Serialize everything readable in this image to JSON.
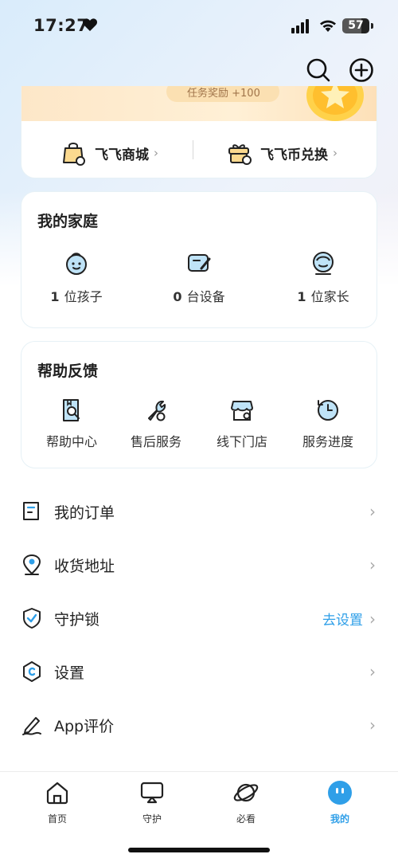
{
  "status_bar": {
    "time": "17:27",
    "battery": "57"
  },
  "header": {
    "icons": [
      "search-icon",
      "add-circle-icon"
    ]
  },
  "shop_card": {
    "banner_text": "任务奖励 +100",
    "items": [
      {
        "label": "飞飞商城",
        "icon": "bag-icon"
      },
      {
        "label": "飞飞币兑换",
        "icon": "gift-exchange-icon"
      }
    ]
  },
  "family": {
    "title": "我的家庭",
    "items": [
      {
        "count": "1",
        "label": "位孩子",
        "icon": "child-face-icon"
      },
      {
        "count": "0",
        "label": "台设备",
        "icon": "tablet-device-icon"
      },
      {
        "count": "1",
        "label": "位家长",
        "icon": "parent-face-icon"
      }
    ]
  },
  "help": {
    "title": "帮助反馈",
    "items": [
      {
        "label": "帮助中心",
        "icon": "help-book-icon"
      },
      {
        "label": "售后服务",
        "icon": "wrench-icon"
      },
      {
        "label": "线下门店",
        "icon": "store-icon"
      },
      {
        "label": "服务进度",
        "icon": "progress-clock-icon"
      }
    ]
  },
  "menu": [
    {
      "label": "我的订单",
      "icon": "order-icon",
      "hint": ""
    },
    {
      "label": "收货地址",
      "icon": "location-icon",
      "hint": ""
    },
    {
      "label": "守护锁",
      "icon": "shield-icon",
      "hint": "去设置"
    },
    {
      "label": "设置",
      "icon": "settings-hex-icon",
      "hint": ""
    },
    {
      "label": "App评价",
      "icon": "pen-icon",
      "hint": ""
    }
  ],
  "tabbar": {
    "tabs": [
      {
        "label": "首页",
        "icon": "home-icon"
      },
      {
        "label": "守护",
        "icon": "guard-screen-icon"
      },
      {
        "label": "必看",
        "icon": "planet-icon"
      },
      {
        "label": "我的",
        "icon": "profile-face-icon",
        "active": true
      }
    ]
  },
  "colors": {
    "accent": "#2f9fe8",
    "icon_fill": "#bfe3f7",
    "text": "#1f1f1f"
  }
}
